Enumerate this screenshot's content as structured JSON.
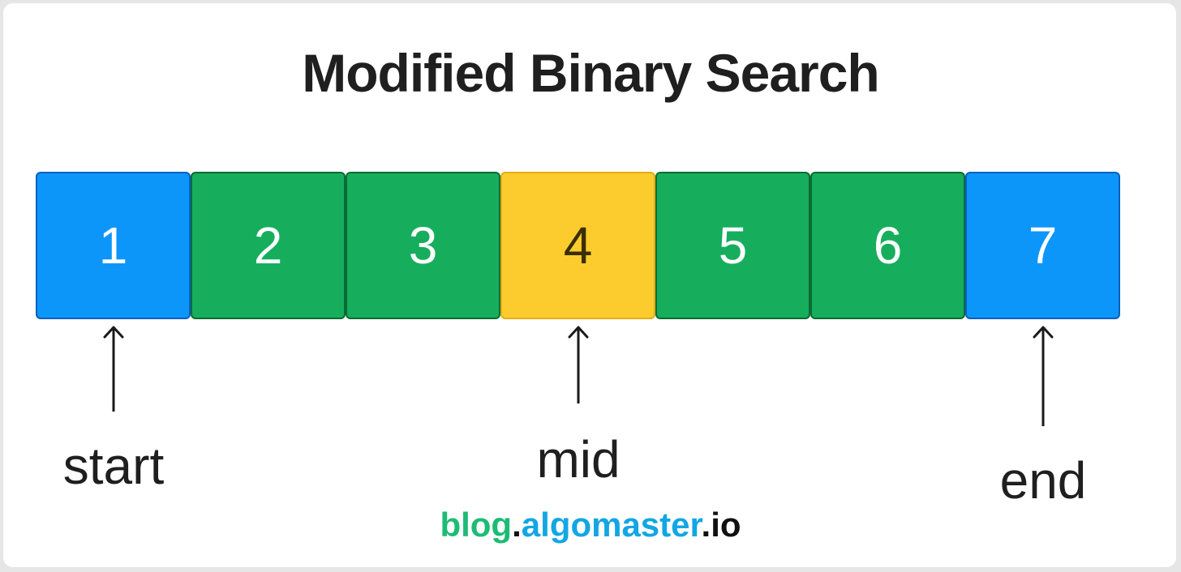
{
  "title": "Modified Binary Search",
  "cells": [
    {
      "value": "1",
      "fill": "#0d96fa",
      "border": "#0a5fc0",
      "text": "#ffffff"
    },
    {
      "value": "2",
      "fill": "#16ae5c",
      "border": "#0b6b32",
      "text": "#ffffff"
    },
    {
      "value": "3",
      "fill": "#16ae5c",
      "border": "#0b6b32",
      "text": "#ffffff"
    },
    {
      "value": "4",
      "fill": "#fccc2e",
      "border": "#e5ad10",
      "text": "#3a2e05"
    },
    {
      "value": "5",
      "fill": "#16ae5c",
      "border": "#0b6b32",
      "text": "#ffffff"
    },
    {
      "value": "6",
      "fill": "#16ae5c",
      "border": "#0b6b32",
      "text": "#ffffff"
    },
    {
      "value": "7",
      "fill": "#0d96fa",
      "border": "#0a5fc0",
      "text": "#ffffff"
    }
  ],
  "pointers": [
    {
      "label": "start",
      "index": 0
    },
    {
      "label": "mid",
      "index": 3
    },
    {
      "label": "end",
      "index": 6
    }
  ],
  "footer": {
    "part1": "blog",
    "dot1": ".",
    "part2": "algomaster",
    "dot2": ".",
    "part3": "io",
    "color1": "#1dbb74",
    "color2": "#12a6e4",
    "color3": "#111111"
  }
}
